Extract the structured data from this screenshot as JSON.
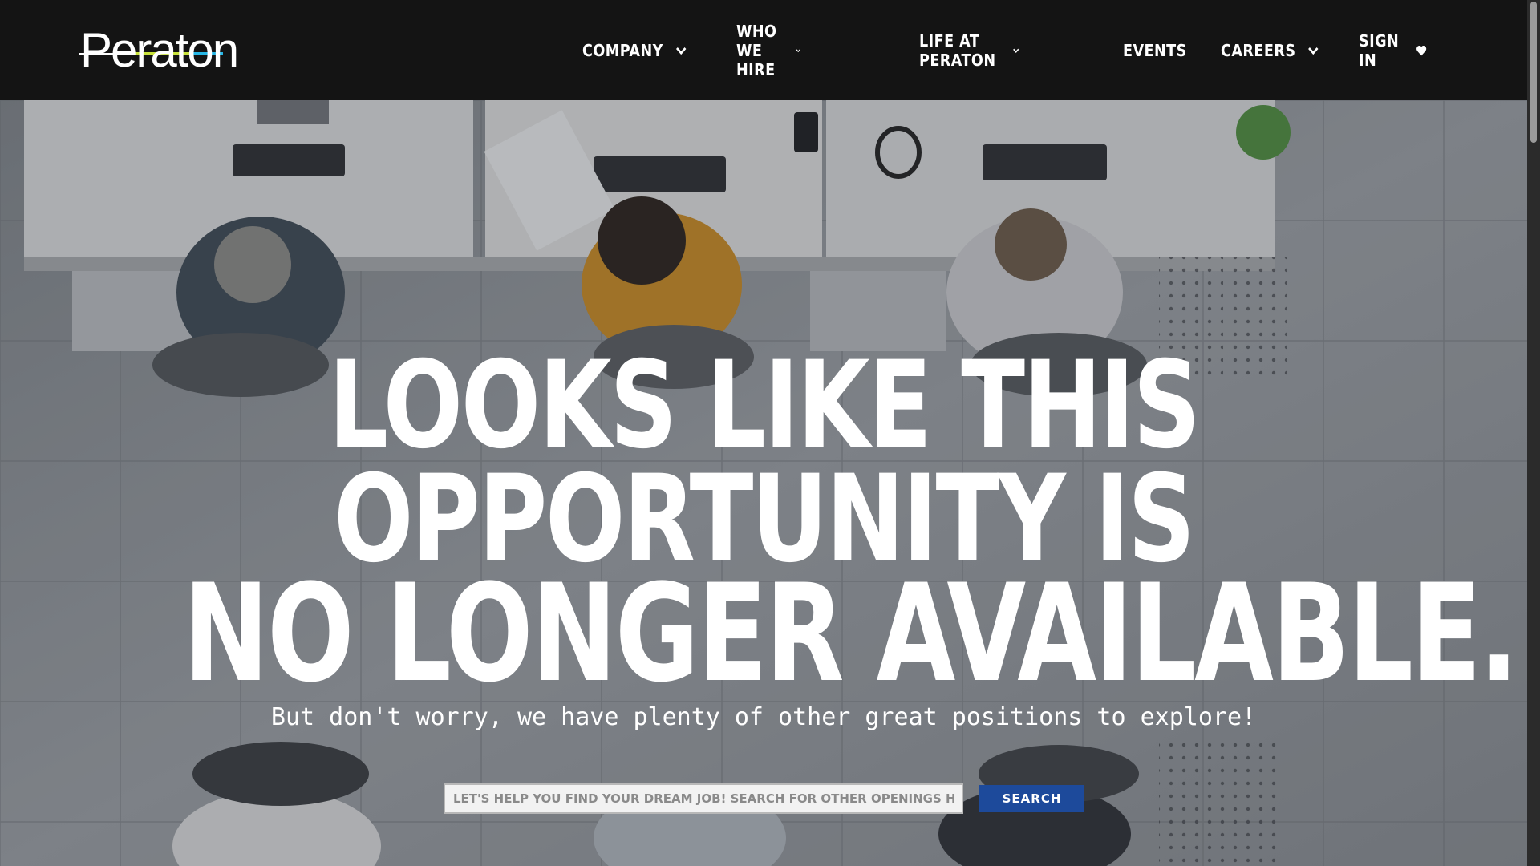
{
  "brand": {
    "logo_text": "Peraton",
    "accent": "#1d4a9b",
    "swoosh_colors": [
      "#c9e23b",
      "#27b7e6",
      "#ffffff"
    ]
  },
  "nav": {
    "items": [
      {
        "label": "COMPANY",
        "has_dropdown": true
      },
      {
        "label": "WHO WE HIRE",
        "has_dropdown": true
      },
      {
        "label": "LIFE AT PERATON",
        "has_dropdown": true
      },
      {
        "label": "EVENTS",
        "has_dropdown": false
      },
      {
        "label": "CAREERS",
        "has_dropdown": true
      }
    ],
    "sign_in": "SIGN IN"
  },
  "hero": {
    "headline": [
      "LOOKS LIKE THIS",
      "OPPORTUNITY IS",
      "NO LONGER AVAILABLE."
    ],
    "subline": "But don't worry, we have plenty of other great positions to explore!",
    "search": {
      "placeholder": "LET'S HELP YOU FIND YOUR DREAM JOB! SEARCH FOR OTHER OPENINGS HERE",
      "button": "SEARCH"
    }
  },
  "icons": {
    "dropdown": "chevron-down-icon",
    "favorites": "heart-icon"
  }
}
